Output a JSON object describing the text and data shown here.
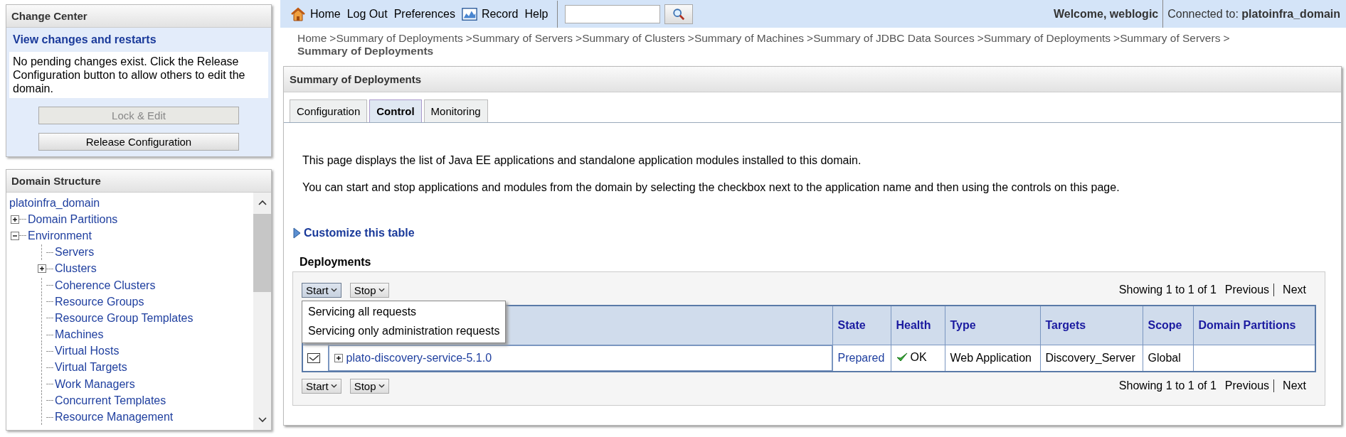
{
  "change_center": {
    "title": "Change Center",
    "link": "View changes and restarts",
    "message": "No pending changes exist. Click the Release Configuration button to allow others to edit the domain.",
    "buttons": [
      {
        "label": "Lock & Edit",
        "disabled": true
      },
      {
        "label": "Release Configuration",
        "disabled": false
      }
    ]
  },
  "domain_structure": {
    "title": "Domain Structure",
    "tree": [
      {
        "label": "platoinfra_domain",
        "children": [
          {
            "label": "Domain Partitions",
            "expanded": false
          },
          {
            "label": "Environment",
            "expanded": true,
            "children": [
              {
                "label": "Servers"
              },
              {
                "label": "Clusters",
                "expanded": false
              },
              {
                "label": "Coherence Clusters"
              },
              {
                "label": "Resource Groups"
              },
              {
                "label": "Resource Group Templates"
              },
              {
                "label": "Machines"
              },
              {
                "label": "Virtual Hosts"
              },
              {
                "label": "Virtual Targets"
              },
              {
                "label": "Work Managers"
              },
              {
                "label": "Concurrent Templates"
              },
              {
                "label": "Resource Management"
              }
            ]
          }
        ]
      }
    ]
  },
  "top_bar": {
    "links": [
      {
        "label": "Home"
      },
      {
        "label": "Log Out"
      },
      {
        "label": "Preferences"
      },
      {
        "label": "Record"
      },
      {
        "label": "Help"
      }
    ],
    "welcome": "Welcome, weblogic",
    "connection": "Connected to: **platoinfra_domain**"
  },
  "breadcrumb": {
    "separator": ">",
    "items": [
      {
        "label": "Home",
        "current": false
      },
      {
        "label": "Summary of Deployments",
        "current": false
      },
      {
        "label": "Summary of Servers",
        "current": false
      },
      {
        "label": "Summary of Clusters",
        "current": false
      },
      {
        "label": "Summary of Machines",
        "current": false
      },
      {
        "label": "Summary of JDBC Data Sources",
        "current": false
      },
      {
        "label": "Summary of Deployments",
        "current": false
      },
      {
        "label": "Summary of Servers",
        "current": false
      },
      {
        "label": "Summary of Deployments",
        "current": true
      }
    ]
  },
  "panel": {
    "title": "Summary of Deployments",
    "tabs": [
      {
        "label": "Configuration",
        "selected": false
      },
      {
        "label": "Control",
        "selected": true
      },
      {
        "label": "Monitoring",
        "selected": false
      }
    ],
    "intro": [
      "This page displays the list of Java EE applications and standalone application modules installed to this domain.",
      "You can start and stop applications and modules from the domain by selecting the checkbox next to the application name and then using the controls on this page."
    ],
    "customize": "Customize this table",
    "deployments": {
      "title": "Deployments",
      "toolbars": [
        {
          "actions": [
            {
              "label": "Start",
              "open": true,
              "menu": [
                "Servicing all requests",
                "Servicing only administration requests"
              ]
            },
            {
              "label": "Stop",
              "open": false
            }
          ],
          "pagination": {
            "summary": "Showing 1 to 1 of 1",
            "previous": "Previous",
            "next": "Next"
          }
        },
        {
          "actions": [
            {
              "label": "Start",
              "open": false
            },
            {
              "label": "Stop",
              "open": false
            }
          ],
          "pagination": {
            "summary": "Showing 1 to 1 of 1",
            "previous": "Previous",
            "next": "Next"
          }
        }
      ],
      "columns": [
        "State",
        "Health",
        "Type",
        "Targets",
        "Scope",
        "Domain Partitions"
      ],
      "rows": [
        {
          "checked": true,
          "expanded": false,
          "name": "plato-discovery-service-5.1.0",
          "state": "Prepared",
          "health": "OK",
          "type": "Web Application",
          "targets": "Discovery_Server",
          "scope": "Global"
        }
      ]
    }
  }
}
